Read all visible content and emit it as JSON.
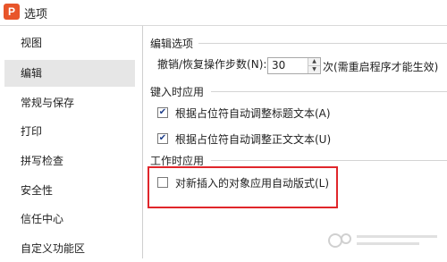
{
  "window": {
    "title": "选项",
    "app_icon_letter": "P"
  },
  "sidebar": {
    "items": [
      {
        "label": "视图",
        "selected": false
      },
      {
        "label": "编辑",
        "selected": true
      },
      {
        "label": "常规与保存",
        "selected": false
      },
      {
        "label": "打印",
        "selected": false
      },
      {
        "label": "拼写检查",
        "selected": false
      },
      {
        "label": "安全性",
        "selected": false
      },
      {
        "label": "信任中心",
        "selected": false
      },
      {
        "label": "自定义功能区",
        "selected": false
      }
    ]
  },
  "editing": {
    "section_title": "编辑选项",
    "undo_steps_label": "撤销/恢复操作步数(N):",
    "undo_steps_value": "30",
    "undo_steps_suffix": "次(需重启程序才能生效)"
  },
  "input_apply": {
    "section_title": "键入时应用",
    "options": [
      {
        "label": "根据占位符自动调整标题文本(A)",
        "checked": true
      },
      {
        "label": "根据占位符自动调整正文文本(U)",
        "checked": true
      }
    ]
  },
  "work_apply": {
    "section_title": "工作时应用",
    "options": [
      {
        "label": "对新插入的对象应用自动版式(L)",
        "checked": false
      }
    ]
  },
  "colors": {
    "highlight_border": "#e0262b",
    "app_icon": "#e8552a",
    "check_mark": "#1f3f8a"
  }
}
